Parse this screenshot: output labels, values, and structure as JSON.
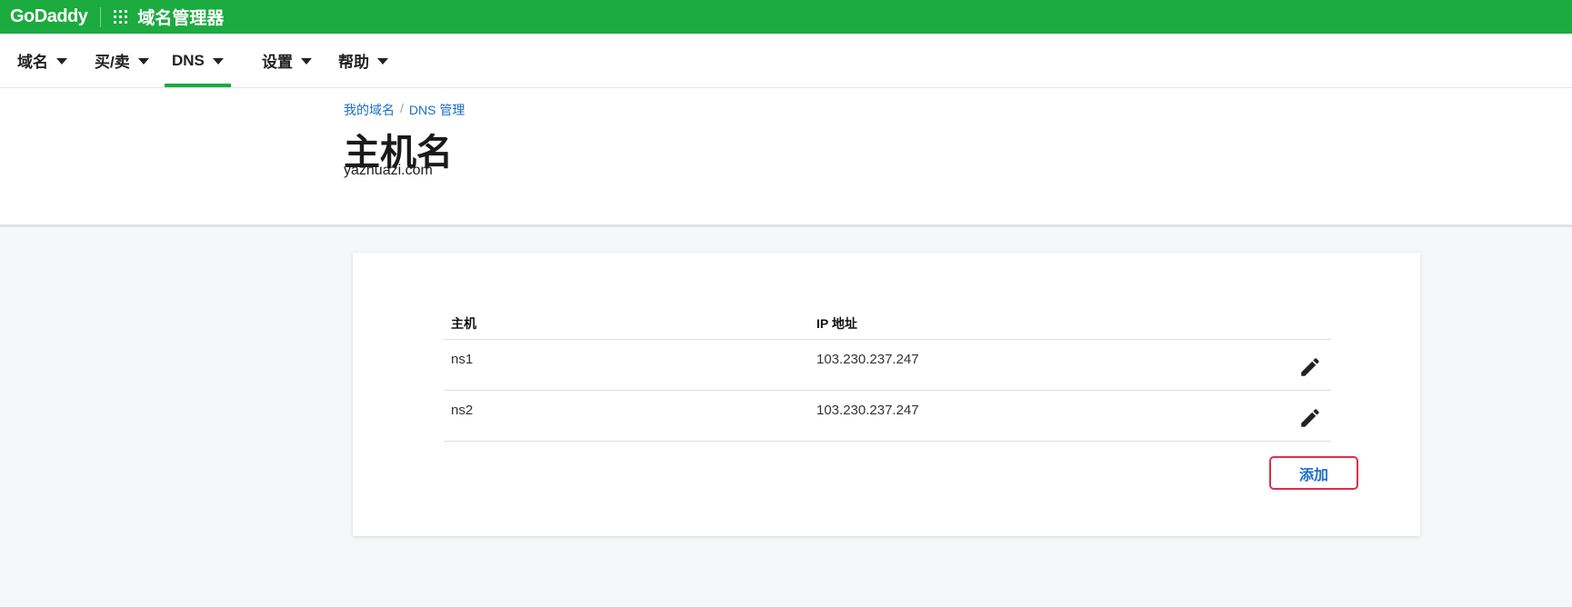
{
  "topbar": {
    "logo": "GoDaddy",
    "app_title": "域名管理器"
  },
  "nav": {
    "items": [
      {
        "label": "域名"
      },
      {
        "label": "买/卖"
      },
      {
        "label": "DNS",
        "active": true
      },
      {
        "label": "设置"
      },
      {
        "label": "帮助"
      }
    ]
  },
  "breadcrumb": {
    "items": [
      "我的域名",
      "DNS 管理"
    ],
    "separator": "/"
  },
  "page": {
    "title": "主机名",
    "domain": "yazhuazi.com"
  },
  "table": {
    "columns": [
      "主机",
      "IP 地址"
    ],
    "rows": [
      {
        "host": "ns1",
        "ip": "103.230.237.247",
        "action_icon": "pencil-edit-icon"
      },
      {
        "host": "ns2",
        "ip": "103.230.237.247",
        "action_icon": "pencil-edit-icon"
      }
    ]
  },
  "actions": {
    "add_label": "添加"
  },
  "colors": {
    "brand_green": "#1bab3f",
    "link_blue": "#1b6fc8",
    "highlight_red": "#e02d4a"
  }
}
